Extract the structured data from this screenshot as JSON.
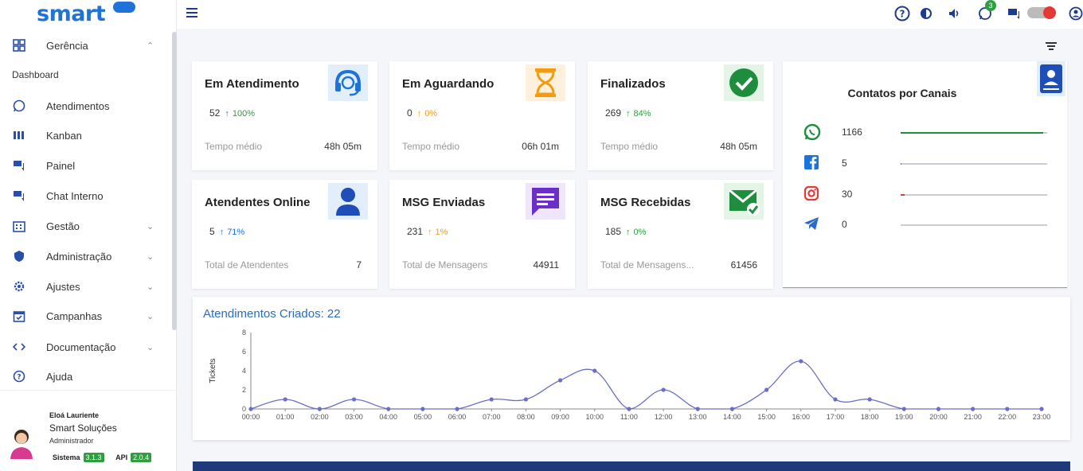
{
  "app": {
    "logo": "smart"
  },
  "sidebar": {
    "items": [
      {
        "label": "Gerência",
        "icon": "grid-icon",
        "chev": "^"
      },
      {
        "label": "Atendimentos",
        "icon": "whatsapp-icon"
      },
      {
        "label": "Kanban",
        "icon": "kanban-icon"
      },
      {
        "label": "Painel",
        "icon": "chat-icon"
      },
      {
        "label": "Chat Interno",
        "icon": "chat-icon"
      },
      {
        "label": "Gestão",
        "icon": "building-icon",
        "chev": "v"
      },
      {
        "label": "Administração",
        "icon": "shield-icon",
        "chev": "v"
      },
      {
        "label": "Ajustes",
        "icon": "gear-icon",
        "chev": "v"
      },
      {
        "label": "Campanhas",
        "icon": "calendar-icon",
        "chev": "v"
      },
      {
        "label": "Documentação",
        "icon": "code-icon",
        "chev": "v"
      },
      {
        "label": "Ajuda",
        "icon": "help-icon"
      }
    ],
    "sub_item": "Dashboard"
  },
  "user": {
    "name": "Eloá Lauriente",
    "org": "Smart Soluções",
    "role": "Administrador",
    "sistema_label": "Sistema",
    "sistema_version": "3.1.3",
    "api_label": "API",
    "api_version": "2.0.4"
  },
  "topbar": {
    "notif_count": "3"
  },
  "cards": [
    {
      "title": "Em Atendimento",
      "stat": "52",
      "pct": "100%",
      "pct_color": "#2e9e3e",
      "foot": "Tempo médio",
      "val": "48h 05m",
      "icon": "headset-icon",
      "icon_color": "#1e73d8",
      "icon_bg": "#e3eefb"
    },
    {
      "title": "Em Aguardando",
      "stat": "0",
      "pct": "0%",
      "pct_color": "#f39c12",
      "foot": "Tempo médio",
      "val": "06h 01m",
      "icon": "hourglass-icon",
      "icon_color": "#f39c12",
      "icon_bg": "#fdf1dd"
    },
    {
      "title": "Finalizados",
      "stat": "269",
      "pct": "84%",
      "pct_color": "#2e9e3e",
      "foot": "Tempo médio",
      "val": "48h 05m",
      "icon": "check-circle-icon",
      "icon_color": "#1e8e3e",
      "icon_bg": "#e4f4e7"
    },
    {
      "title": "Atendentes Online",
      "stat": "5",
      "pct": "71%",
      "pct_color": "#1e73d8",
      "foot": "Total de Atendentes",
      "val": "7",
      "icon": "person-icon",
      "icon_color": "#1e4fb8",
      "icon_bg": "#e3eefb"
    },
    {
      "title": "MSG Enviadas",
      "stat": "231",
      "pct": "1%",
      "pct_color": "#f39c12",
      "foot": "Total de Mensagens",
      "val": "44911",
      "icon": "message-icon",
      "icon_color": "#6a2fc8",
      "icon_bg": "#efe6fb"
    },
    {
      "title": "MSG Recebidas",
      "stat": "185",
      "pct": "0%",
      "pct_color": "#2e9e3e",
      "foot": "Total de Mensagens...",
      "val": "61456",
      "icon": "mail-check-icon",
      "icon_color": "#1e8e3e",
      "icon_bg": "#e4f4e7"
    }
  ],
  "canais": {
    "title": "Contatos por Canais",
    "rows": [
      {
        "name": "whatsapp-icon",
        "value": "1166",
        "color": "#1e8e3e"
      },
      {
        "name": "facebook-icon",
        "value": "5",
        "color": "#1e73d8"
      },
      {
        "name": "instagram-icon",
        "value": "30",
        "color": "#e53935"
      },
      {
        "name": "telegram-icon",
        "value": "0",
        "color": "#2a6cc4"
      }
    ]
  },
  "chart_title": "Atendimentos Criados: 22",
  "chart_data": {
    "type": "line",
    "title": "Atendimentos Criados: 22",
    "ylabel": "Tickets",
    "xlabel": "",
    "ylim": [
      0,
      8
    ],
    "yticks": [
      "0",
      "2",
      "4",
      "6",
      "8"
    ],
    "categories": [
      "00:00",
      "01:00",
      "02:00",
      "03:00",
      "04:00",
      "05:00",
      "06:00",
      "07:00",
      "08:00",
      "09:00",
      "10:00",
      "11:00",
      "12:00",
      "13:00",
      "14:00",
      "15:00",
      "16:00",
      "17:00",
      "18:00",
      "19:00",
      "20:00",
      "21:00",
      "22:00",
      "23:00"
    ],
    "values": [
      0,
      1,
      0,
      1,
      0,
      0,
      0,
      1,
      1,
      3,
      4,
      0,
      2,
      0,
      0,
      2,
      5,
      1,
      1,
      0,
      0,
      0,
      0,
      0
    ],
    "color": "#6a6fc4"
  }
}
